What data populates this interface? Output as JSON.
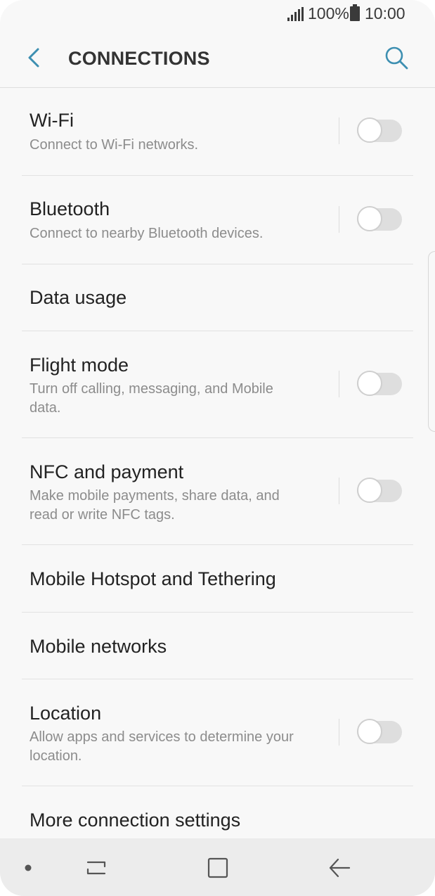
{
  "statusbar": {
    "battery": "100%",
    "time": "10:00"
  },
  "header": {
    "title": "CONNECTIONS"
  },
  "items": [
    {
      "title": "Wi-Fi",
      "subtitle": "Connect to Wi-Fi networks.",
      "toggle": "off"
    },
    {
      "title": "Bluetooth",
      "subtitle": "Connect to nearby Bluetooth devices.",
      "toggle": "off"
    },
    {
      "title": "Data usage"
    },
    {
      "title": "Flight mode",
      "subtitle": "Turn off calling, messaging, and Mobile data.",
      "toggle": "off"
    },
    {
      "title": "NFC and payment",
      "subtitle": "Make mobile payments, share data, and read or write NFC tags.",
      "toggle": "off"
    },
    {
      "title": "Mobile Hotspot and Tethering"
    },
    {
      "title": "Mobile networks"
    },
    {
      "title": "Location",
      "subtitle": "Allow apps and services to determine your location.",
      "toggle": "off"
    },
    {
      "title": "More connection settings"
    }
  ],
  "colors": {
    "accent": "#3d8fb1",
    "background": "#f8f8f8"
  }
}
